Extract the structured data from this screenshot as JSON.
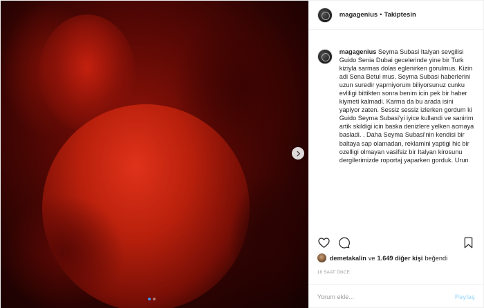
{
  "header": {
    "username": "magagenius",
    "separator": "•",
    "follow_status": "Takiptesin"
  },
  "caption": {
    "username": "magagenius",
    "text": "Seyma Subasi Italyan sevgilisi Guido Senia Dubai gecelerinde yine bir Turk kiziyla sarmas dolas eglenirken gorulmus. Kizin adi Sena Betul mus. Seyma Subasi haberlerini uzun suredir yapmiyorum biliyorsunuz cunku evliligi bittikten sonra benim icin pek bir haber kiymeti kalmadi. Karma da bu arada isini yapiyor zaten. Sessiz sessiz izlerken gordum ki Guido Seyma Subasi'yi iyice kullandi ve sanirim artik skildigi icin baska denizlere yelken acmaya basladi. . Daha Seyma Subasi'nin kendisi bir baltaya sap olamadan, reklamini yaptigi hic bir ozelligi olmayan vasifsiz bir Italyan kirosunu dergilerimizde roportaj yaparken gorduk. Urun"
  },
  "media": {
    "carousel_total": 2,
    "carousel_index": 0
  },
  "actions": {
    "like_icon": "heart-icon",
    "comment_icon": "comment-icon",
    "save_icon": "bookmark-icon"
  },
  "likes": {
    "user": "demetakalin",
    "and": "ve",
    "count": "1.649 diğer kişi",
    "verb": "beğendi"
  },
  "timestamp": "18 SAAT ÖNCE",
  "comment_box": {
    "placeholder": "Yorum ekle...",
    "post_label": "Paylaş"
  },
  "colors": {
    "accent": "#3897f0",
    "post_disabled": "#b2dffc",
    "text": "#262626",
    "muted": "#999999"
  }
}
